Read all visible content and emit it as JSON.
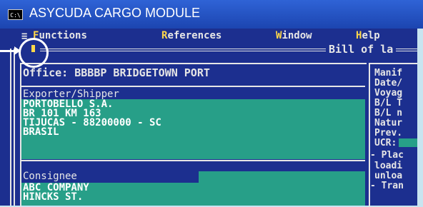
{
  "window": {
    "icon_text": "C:\\",
    "title": "ASYCUDA CARGO MODULE"
  },
  "menu": {
    "items": [
      {
        "hot": "F",
        "rest": "unctions"
      },
      {
        "hot": "R",
        "rest": "eferences"
      },
      {
        "hot": "W",
        "rest": "indow"
      },
      {
        "hot": "H",
        "rest": "elp"
      }
    ],
    "system_glyph": "≡"
  },
  "form": {
    "title": "Bill of la",
    "office": "Office: BBBBP BRIDGETOWN PORT",
    "exporter_label": "Exporter/Shipper",
    "exporter_lines": [
      "PORTOBELLO S.A.",
      "BR 101 KM 163",
      "TIJUCAS - 88200000 - SC",
      "BRASIL"
    ],
    "consignee_label": "Consignee",
    "consignee_lines": [
      "ABC COMPANY",
      "HINCKS ST."
    ],
    "side_labels": [
      "Manif",
      "Date/",
      "Voyag",
      "B/L T",
      "B/L n",
      "Natur",
      "Prev.",
      "UCR:",
      "- Plac",
      "loadi",
      "unloa",
      "- Tran"
    ]
  },
  "colors": {
    "console_bg": "#1c2f8f",
    "field_bg": "#279f88",
    "title_bar": "#2f63d6"
  }
}
